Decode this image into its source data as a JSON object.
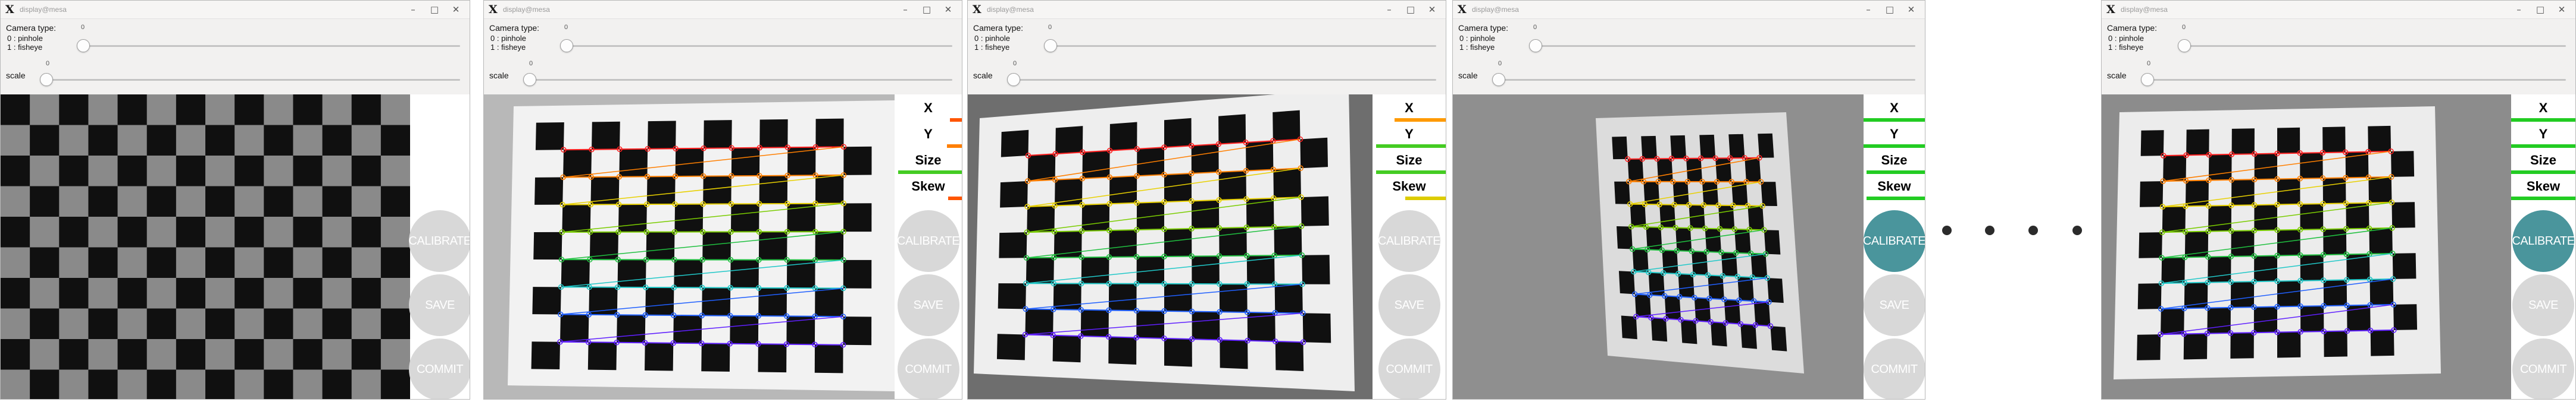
{
  "windows": [
    {
      "title": "display@mesa",
      "camera_type_label": "Camera type:",
      "camera_type_value": "0",
      "camera_options": [
        "0 : pinhole",
        "1 : fisheye"
      ],
      "scale_label": "scale",
      "scale_value": "0",
      "metrics": [],
      "buttons": [
        {
          "label": "CALIBRATE",
          "active": false
        },
        {
          "label": "SAVE",
          "active": false
        },
        {
          "label": "COMMIT",
          "active": false
        }
      ],
      "detection": "none"
    },
    {
      "title": "display@mesa",
      "camera_type_label": "Camera type:",
      "camera_type_value": "0",
      "camera_options": [
        "0 : pinhole",
        "1 : fisheye"
      ],
      "scale_label": "scale",
      "scale_value": "0",
      "metrics": [
        {
          "label": "X",
          "progress": 0.18,
          "color": "#ff5500"
        },
        {
          "label": "Y",
          "progress": 0.22,
          "color": "#ff7f00"
        },
        {
          "label": "Size",
          "progress": 0.95,
          "color": "#44cc22"
        },
        {
          "label": "Skew",
          "progress": 0.2,
          "color": "#ff5500"
        }
      ],
      "buttons": [
        {
          "label": "CALIBRATE",
          "active": false
        },
        {
          "label": "SAVE",
          "active": false
        },
        {
          "label": "COMMIT",
          "active": false
        }
      ],
      "detection": "corners"
    },
    {
      "title": "display@mesa",
      "camera_type_label": "Camera type:",
      "camera_type_value": "0",
      "camera_options": [
        "0 : pinhole",
        "1 : fisheye"
      ],
      "scale_label": "scale",
      "scale_value": "0",
      "metrics": [
        {
          "label": "X",
          "progress": 0.7,
          "color": "#ff9a00"
        },
        {
          "label": "Y",
          "progress": 0.95,
          "color": "#44cc22"
        },
        {
          "label": "Size",
          "progress": 0.95,
          "color": "#44cc22"
        },
        {
          "label": "Skew",
          "progress": 0.55,
          "color": "#ddcc00"
        }
      ],
      "buttons": [
        {
          "label": "CALIBRATE",
          "active": false
        },
        {
          "label": "SAVE",
          "active": false
        },
        {
          "label": "COMMIT",
          "active": false
        }
      ],
      "detection": "corners"
    },
    {
      "title": "display@mesa",
      "camera_type_label": "Camera type:",
      "camera_type_value": "0",
      "camera_options": [
        "0 : pinhole",
        "1 : fisheye"
      ],
      "scale_label": "scale",
      "scale_value": "0",
      "metrics": [
        {
          "label": "X",
          "progress": 1.0,
          "color": "#22cc22"
        },
        {
          "label": "Y",
          "progress": 1.0,
          "color": "#22cc22"
        },
        {
          "label": "Size",
          "progress": 0.95,
          "color": "#22cc22"
        },
        {
          "label": "Skew",
          "progress": 0.95,
          "color": "#22cc22"
        }
      ],
      "buttons": [
        {
          "label": "CALIBRATE",
          "active": true
        },
        {
          "label": "SAVE",
          "active": false
        },
        {
          "label": "COMMIT",
          "active": false
        }
      ],
      "detection": "corners"
    },
    {
      "title": "display@mesa",
      "camera_type_label": "Camera type:",
      "camera_type_value": "0",
      "camera_options": [
        "0 : pinhole",
        "1 : fisheye"
      ],
      "scale_label": "scale",
      "scale_value": "0",
      "metrics": [
        {
          "label": "X",
          "progress": 1.0,
          "color": "#22cc22"
        },
        {
          "label": "Y",
          "progress": 1.0,
          "color": "#22cc22"
        },
        {
          "label": "Size",
          "progress": 1.0,
          "color": "#22cc22"
        },
        {
          "label": "Skew",
          "progress": 1.0,
          "color": "#22cc22"
        }
      ],
      "buttons": [
        {
          "label": "CALIBRATE",
          "active": true
        },
        {
          "label": "SAVE",
          "active": false
        },
        {
          "label": "COMMIT",
          "active": false
        }
      ],
      "detection": "corners"
    }
  ],
  "icons": {
    "app": "x-logo-icon",
    "minimize": "minimize-icon",
    "maximize": "maximize-icon",
    "close": "close-icon",
    "ellipsis": "ellipsis-dots"
  }
}
